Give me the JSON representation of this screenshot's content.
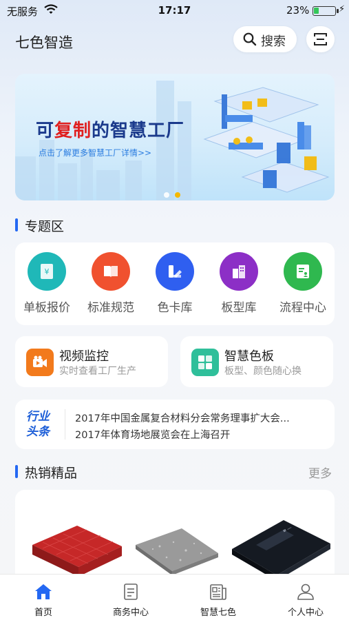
{
  "status_bar": {
    "carrier": "无服务",
    "time": "17:17",
    "battery_percent": "23%",
    "battery_level": 0.23
  },
  "header": {
    "app_title": "七色智造",
    "search_label": "搜索"
  },
  "banner": {
    "headline_part1": "可",
    "headline_accent": "复制",
    "headline_part2": "的智慧工厂",
    "subline": "点击了解更多智慧工厂详情>>",
    "page_count": 2,
    "active_page": 2
  },
  "topics": {
    "title": "专题区",
    "items": [
      {
        "label": "单板报价",
        "icon": "yuan-doc-icon",
        "color": "#1fb8b8"
      },
      {
        "label": "标准规范",
        "icon": "book-icon",
        "color": "#f0512f"
      },
      {
        "label": "色卡库",
        "icon": "palette-icon",
        "color": "#2f5ff0"
      },
      {
        "label": "板型库",
        "icon": "building-icon",
        "color": "#8c2fc6"
      },
      {
        "label": "流程中心",
        "icon": "clipboard-icon",
        "color": "#2fb84f"
      }
    ]
  },
  "features": [
    {
      "title": "视频监控",
      "subtitle": "实时查看工厂生产",
      "icon": "video-camera-icon",
      "color": "#f27a1c"
    },
    {
      "title": "智慧色板",
      "subtitle": "板型、颜色随心换",
      "icon": "grid-icon",
      "color": "#2fbf9a"
    }
  ],
  "news": {
    "logo_line1": "行业",
    "logo_line2": "头条",
    "items": [
      "2017年中国金属复合材料分会常务理事扩大会...",
      "2017年体育场地展览会在上海召开"
    ]
  },
  "hot": {
    "title": "热销精品",
    "more": "更多"
  },
  "tabbar": {
    "items": [
      {
        "label": "首页",
        "icon": "home-icon",
        "active": true
      },
      {
        "label": "商务中心",
        "icon": "document-icon",
        "active": false
      },
      {
        "label": "智慧七色",
        "icon": "newspaper-icon",
        "active": false
      },
      {
        "label": "个人中心",
        "icon": "person-icon",
        "active": false
      }
    ]
  },
  "colors": {
    "accent": "#2468f2",
    "headline": "#1b3a8c",
    "headline_accent": "#e02020"
  }
}
